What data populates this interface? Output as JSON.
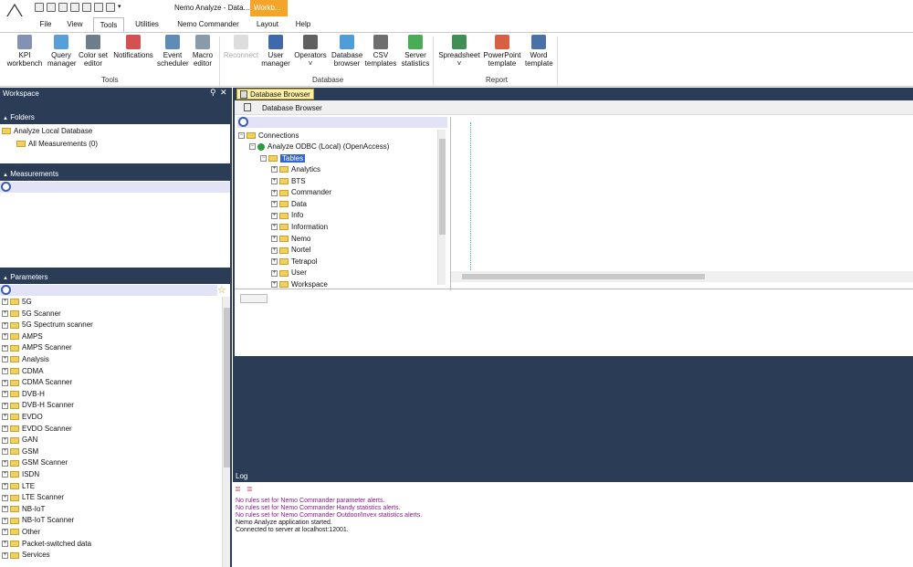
{
  "titlebar": {
    "title": "Nemo Analyze - Data...",
    "context_tab": "Workb..."
  },
  "tabs": [
    "File",
    "View",
    "Tools",
    "Utilities",
    "Nemo Commander",
    "Layout",
    "Help"
  ],
  "active_tab": "Tools",
  "ribbon": {
    "buttons": [
      {
        "line1": "KPI",
        "line2": "workbench",
        "icon": "kpi-icon",
        "color": "#6b7fa8"
      },
      {
        "line1": "Query",
        "line2": "manager",
        "icon": "query-icon",
        "color": "#3a8fd0"
      },
      {
        "line1": "Color set",
        "line2": "editor",
        "icon": "color-set-icon",
        "color": "#556677"
      },
      {
        "line1": "Notifications",
        "line2": "",
        "icon": "notification-icon",
        "color": "#c33"
      },
      {
        "line1": "Event",
        "line2": "scheduler",
        "icon": "event-scheduler-icon",
        "color": "#4477aa"
      },
      {
        "line1": "Macro",
        "line2": "editor",
        "icon": "macro-icon",
        "color": "#778899"
      },
      {
        "line1": "Reconnect",
        "line2": "",
        "icon": "reconnect-icon",
        "color": "#aaaaaa"
      },
      {
        "line1": "User",
        "line2": "manager",
        "icon": "user-icon",
        "color": "#1f4f9c"
      },
      {
        "line1": "Operators",
        "line2": "˅",
        "icon": "operators-icon",
        "color": "#444"
      },
      {
        "line1": "Database",
        "line2": "browser",
        "icon": "database-icon",
        "color": "#2f8ccf"
      },
      {
        "line1": "CSV",
        "line2": "templates",
        "icon": "csv-icon",
        "color": "#555"
      },
      {
        "line1": "Server",
        "line2": "statistics",
        "icon": "server-statistics-icon",
        "color": "#2a9d3a"
      },
      {
        "line1": "Spreadsheet",
        "line2": "˅",
        "icon": "excel-icon",
        "color": "#1e7b3a"
      },
      {
        "line1": "PowerPoint",
        "line2": "template",
        "icon": "powerpoint-icon",
        "color": "#d04423"
      },
      {
        "line1": "Word",
        "line2": "template",
        "icon": "word-icon",
        "color": "#2b5797"
      }
    ],
    "groups": [
      "Tools",
      "Database",
      "Report"
    ]
  },
  "workspace": {
    "title": "Workspace",
    "folders_label": "Folders",
    "folder_root": "Analyze Local Database",
    "folder_child": "All Measurements (0)",
    "measurements_label": "Measurements",
    "parameters_label": "Parameters",
    "parameters": [
      "5G",
      "5G Scanner",
      "5G Spectrum scanner",
      "AMPS",
      "AMPS Scanner",
      "Analysis",
      "CDMA",
      "CDMA Scanner",
      "DVB-H",
      "DVB-H Scanner",
      "EVDO",
      "EVDO Scanner",
      "GAN",
      "GSM",
      "GSM Scanner",
      "ISDN",
      "LTE",
      "LTE Scanner",
      "NB-IoT",
      "NB-IoT Scanner",
      "Other",
      "Packet-switched data",
      "Services"
    ]
  },
  "db_browser": {
    "tab_label": "Database Browser",
    "title": "Database Browser",
    "connections": "Connections",
    "odbc": "Analyze ODBC (Local) (OpenAccess)",
    "tables": "Tables",
    "table_items": [
      "Analytics",
      "BTS",
      "Commander",
      "Data",
      "Info",
      "Information",
      "Nemo",
      "Nortel",
      "Tetrapol",
      "User",
      "Workspace"
    ]
  },
  "log": {
    "title": "Log",
    "lines": [
      {
        "text": "No rules set for Nemo Commander parameter alerts.",
        "color": "#8b1a8b"
      },
      {
        "text": "No rules set for Nemo Commander Handy statistics alerts.",
        "color": "#8b1a8b"
      },
      {
        "text": "No rules set for Nemo Commander Outdoor/Invex statistics alerts.",
        "color": "#8b1a8b"
      },
      {
        "text": "Nemo Analyze application started.",
        "color": "#111111"
      },
      {
        "text": "Connected to server at localhost:12001.",
        "color": "#111111"
      }
    ]
  }
}
